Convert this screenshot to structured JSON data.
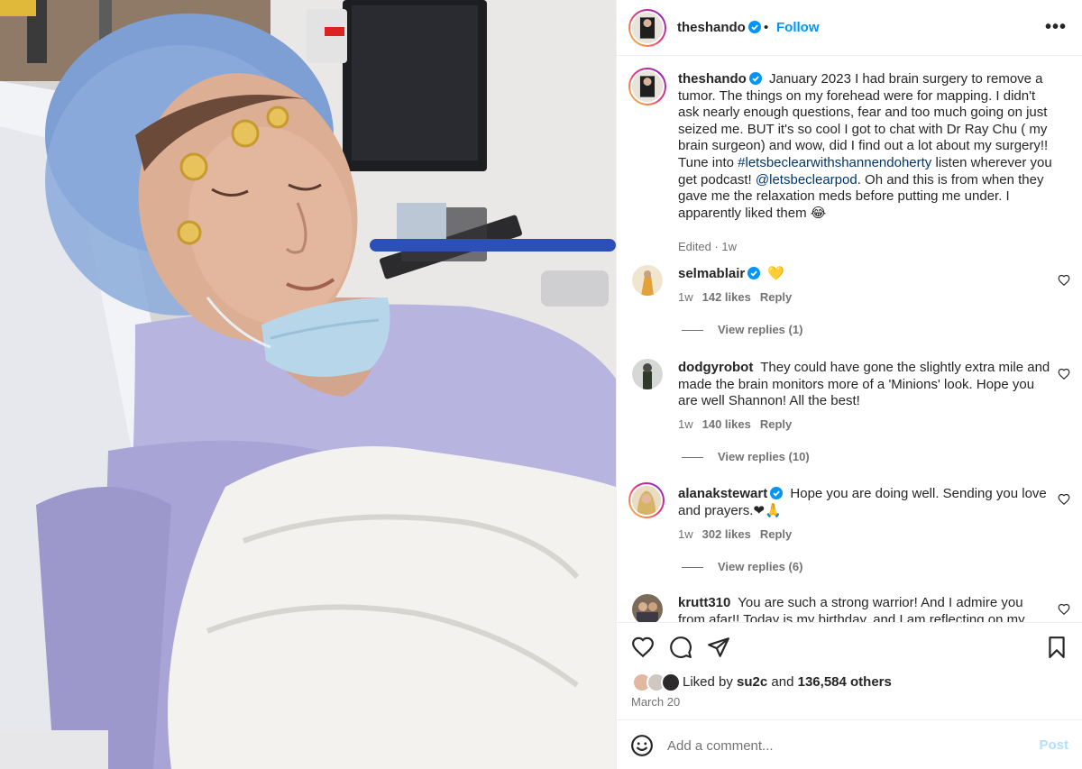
{
  "post": {
    "author": "theshando",
    "verified_icon": "verified-badge-icon",
    "follow_label": "Follow",
    "separator": "•",
    "more_label": "•••",
    "caption_parts": [
      "January 2023 I had brain surgery to remove a tumor. The things on my forehead were for mapping. I didn't ask nearly enough questions, fear and too much going on just seized me. BUT it's so cool I got to chat with Dr Ray Chu ( my brain surgeon) and wow, did I find out a lot about my surgery!! Tune into ",
      "#letsbeclearwithshannendoherty",
      " listen wherever you get podcast! ",
      "@letsbeclearpod",
      ". Oh and this is from when they gave me the relaxation meds before putting me under. I apparently liked them 😂"
    ],
    "caption_meta": "Edited · 1w"
  },
  "comments": [
    {
      "user": "selmablair",
      "verified": true,
      "text": "💛",
      "time": "1w",
      "likes": "142 likes",
      "reply_label": "Reply",
      "view_replies": "View replies (1)"
    },
    {
      "user": "dodgyrobot",
      "verified": false,
      "text": "They could have gone the slightly extra mile and made the brain monitors more of a 'Minions' look. Hope you are well Shannon! All the best!",
      "time": "1w",
      "likes": "140 likes",
      "reply_label": "Reply",
      "view_replies": "View replies (10)"
    },
    {
      "user": "alanakstewart",
      "verified": true,
      "text": "Hope you are doing well. Sending you love and prayers.❤🙏",
      "time": "1w",
      "likes": "302 likes",
      "reply_label": "Reply",
      "view_replies": "View replies (6)"
    },
    {
      "user": "krutt310",
      "verified": false,
      "text": "You are such a strong warrior! And I admire you from afar!! Today is my birthday, and I am reflecting on my",
      "time": "",
      "likes": "",
      "reply_label": "",
      "view_replies": ""
    }
  ],
  "actions": {
    "liked_prefix": "Liked by",
    "liked_user": "su2c",
    "liked_and": "and",
    "liked_others": "136,584 others",
    "date": "March 20"
  },
  "composer": {
    "placeholder": "Add a comment...",
    "post_label": "Post"
  },
  "colors": {
    "accent": "#0095f6",
    "link": "#00376b",
    "muted": "#737373",
    "post_disabled": "#b2dffc"
  }
}
